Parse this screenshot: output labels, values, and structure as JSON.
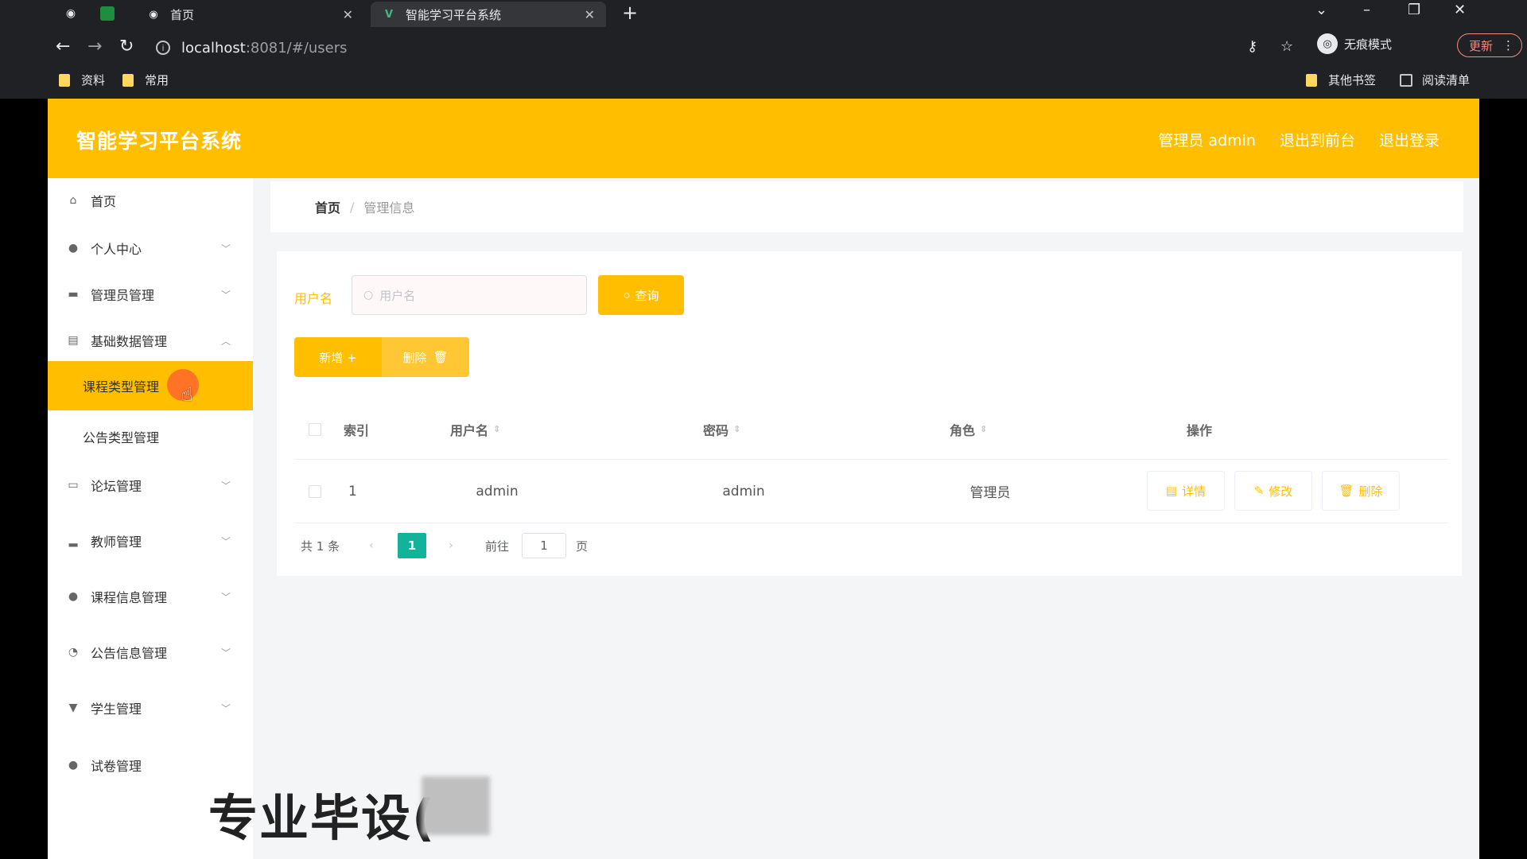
{
  "browser": {
    "tabs": [
      {
        "label": "首页"
      },
      {
        "label": "智能学习平台系统"
      }
    ],
    "url_host": "localhost",
    "url_rest": ":8081/#/users",
    "incognito_label": "无痕模式",
    "update_label": "更新",
    "bookmarks": [
      {
        "label": "资料"
      },
      {
        "label": "常用"
      }
    ],
    "other_bookmarks": "其他书签",
    "reading_list": "阅读清单"
  },
  "app": {
    "title": "智能学习平台系统",
    "header_links": {
      "admin": "管理员 admin",
      "front": "退出到前台",
      "logout": "退出登录"
    }
  },
  "sidebar": {
    "items": [
      {
        "label": "首页",
        "icon": "home-icon"
      },
      {
        "label": "个人中心",
        "icon": "user-icon"
      },
      {
        "label": "管理员管理",
        "icon": "briefcase-icon"
      },
      {
        "label": "基础数据管理",
        "icon": "clipboard-icon"
      },
      {
        "label": "课程类型管理"
      },
      {
        "label": "公告类型管理"
      },
      {
        "label": "论坛管理",
        "icon": "chat-icon"
      },
      {
        "label": "教师管理",
        "icon": "chart-icon"
      },
      {
        "label": "课程信息管理",
        "icon": "user-icon"
      },
      {
        "label": "公告信息管理",
        "icon": "compass-icon"
      },
      {
        "label": "学生管理",
        "icon": "trophy-icon"
      },
      {
        "label": "试卷管理",
        "icon": "bulb-icon"
      }
    ]
  },
  "breadcrumb": {
    "home": "首页",
    "separator": "/",
    "current": "管理信息"
  },
  "search": {
    "label": "用户名",
    "placeholder": "用户名",
    "button": "查询"
  },
  "actions": {
    "add": "新增 +",
    "delete": "删除"
  },
  "table": {
    "headers": {
      "index": "索引",
      "username": "用户名",
      "password": "密码",
      "role": "角色",
      "ops": "操作"
    },
    "rows": [
      {
        "index": "1",
        "username": "admin",
        "password": "admin",
        "role": "管理员"
      }
    ],
    "row_buttons": {
      "detail": "详情",
      "edit": "修改",
      "delete": "删除"
    }
  },
  "pagination": {
    "total": "共 1 条",
    "current": "1",
    "goto": "前往",
    "input": "1",
    "unit": "页"
  },
  "overlay": {
    "watermark": "专业毕设("
  },
  "colors": {
    "accent": "#ffbf00",
    "page_active": "#13b29b"
  }
}
